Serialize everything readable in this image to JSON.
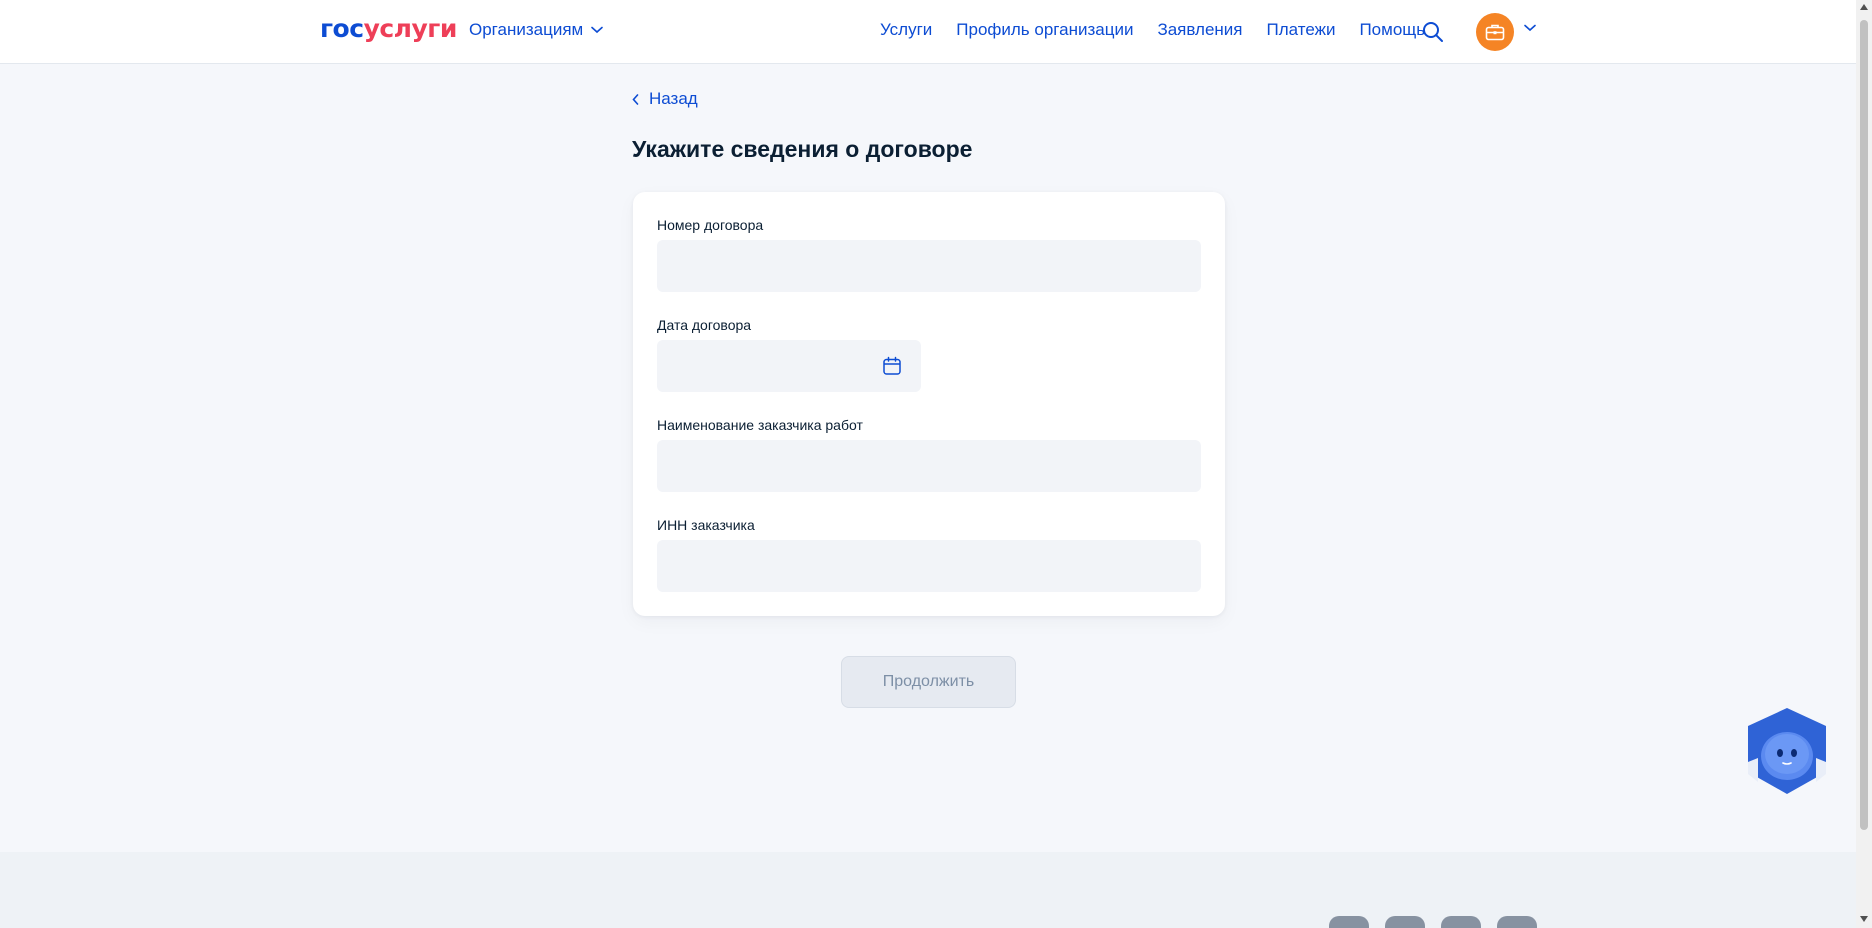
{
  "header": {
    "logo": {
      "part1": "гос",
      "part2": "услуги"
    },
    "org_menu_label": "Организациям",
    "nav": [
      "Услуги",
      "Профиль организации",
      "Заявления",
      "Платежи",
      "Помощь"
    ]
  },
  "main": {
    "back_label": "Назад",
    "title": "Укажите сведения о договоре",
    "fields": {
      "contract_number": {
        "label": "Номер договора",
        "value": ""
      },
      "contract_date": {
        "label": "Дата договора",
        "value": ""
      },
      "customer_name": {
        "label": "Наименование заказчика работ",
        "value": ""
      },
      "customer_inn": {
        "label": "ИНН заказчика",
        "value": ""
      }
    },
    "continue_label": "Продолжить"
  },
  "icons": {
    "search": "search-icon",
    "avatar": "briefcase-icon",
    "calendar": "calendar-icon",
    "robot": "robot-assistant-icon"
  },
  "colors": {
    "brand_blue": "#0d4cd3",
    "brand_red": "#ee3f58",
    "avatar_orange": "#f58425",
    "page_bg": "#f5f7fb",
    "input_bg": "#f2f4f8"
  }
}
